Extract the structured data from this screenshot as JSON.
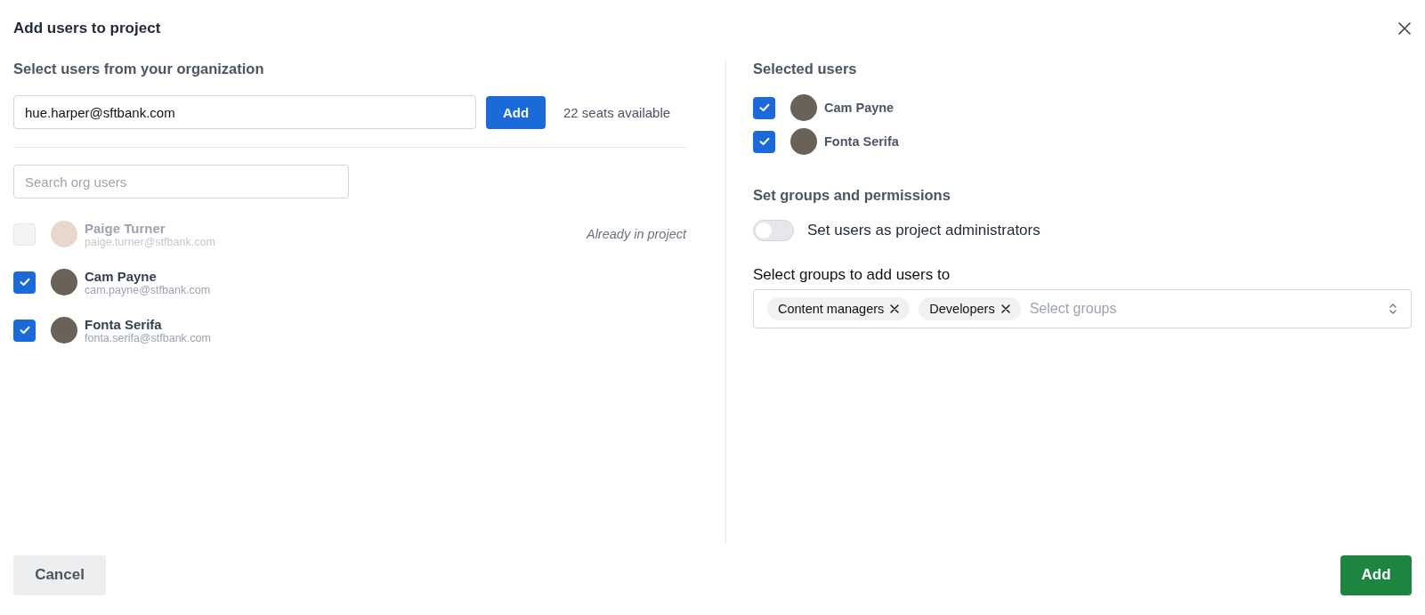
{
  "dialog": {
    "title": "Add users to project"
  },
  "left": {
    "heading": "Select users from your organization",
    "email_field": {
      "value": "hue.harper@sftbank.com"
    },
    "add_button": "Add",
    "seats": "22 seats available",
    "search": {
      "placeholder": "Search org users"
    },
    "users": [
      {
        "name": "Paige Turner",
        "email": "paige.turner@stfbank.com",
        "checked": false,
        "disabled": true,
        "note": "Already in project"
      },
      {
        "name": "Cam Payne",
        "email": "cam.payne@stfbank.com",
        "checked": true,
        "disabled": false
      },
      {
        "name": "Fonta Serifa",
        "email": "fonta.serifa@stfbank.com",
        "checked": true,
        "disabled": false
      }
    ]
  },
  "right": {
    "heading": "Selected users",
    "selected_users": [
      {
        "name": "Cam Payne",
        "checked": true
      },
      {
        "name": "Fonta Serifa",
        "checked": true
      }
    ],
    "permissions_heading": "Set groups and permissions",
    "admin_toggle": {
      "label": "Set users as project administrators",
      "on": false
    },
    "groups_label": "Select groups to add users to",
    "groups": {
      "chips": [
        "Content managers",
        "Developers"
      ],
      "placeholder": "Select groups"
    }
  },
  "footer": {
    "cancel": "Cancel",
    "add": "Add"
  }
}
